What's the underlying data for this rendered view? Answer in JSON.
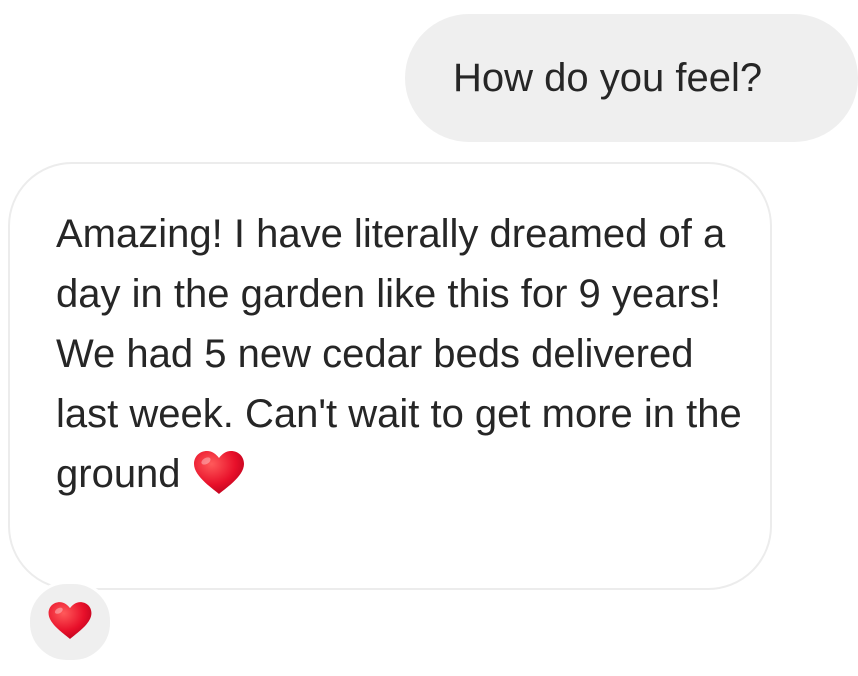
{
  "conversation": {
    "sent_message": {
      "text": "How do you feel?"
    },
    "received_message": {
      "text": "Amazing! I have literally dreamed of a day in the garden like this for 9 years! We had 5 new cedar beds delivered last week. Can't wait to get more in the ground",
      "emoji_icon": "red-heart-icon"
    },
    "reaction": {
      "icon": "red-heart-icon"
    }
  },
  "colors": {
    "sent_bubble": "#efefef",
    "received_border": "#ececec",
    "text": "#262626",
    "heart": "#e8102a"
  }
}
